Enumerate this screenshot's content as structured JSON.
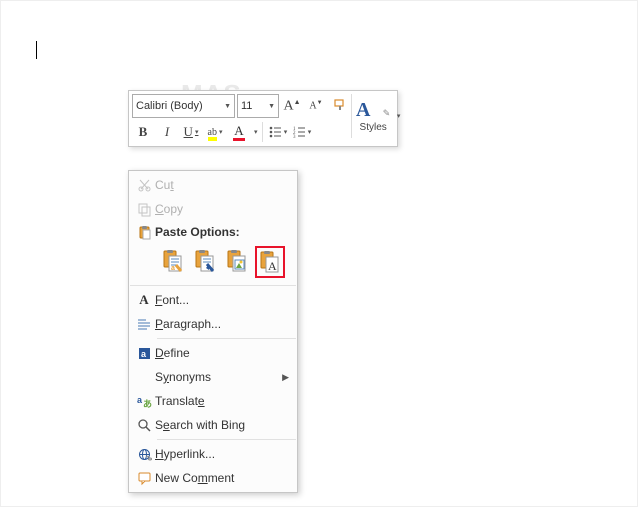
{
  "toolbar": {
    "font_name": "Calibri (Body)",
    "font_size": "11",
    "styles_label": "Styles"
  },
  "contextMenu": {
    "cut": "Cut",
    "copy": "Copy",
    "paste_header": "Paste Options:",
    "font": "Font...",
    "paragraph": "Paragraph...",
    "define": "Define",
    "synonyms": "Synonyms",
    "translate": "Translate",
    "search_bing": "Search with Bing",
    "hyperlink": "Hyperlink...",
    "new_comment": "New Comment"
  }
}
